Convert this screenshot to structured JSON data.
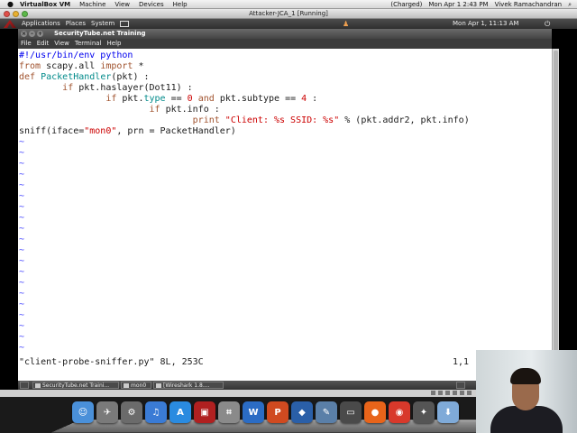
{
  "mac_menubar": {
    "apple": "",
    "menus": [
      "VirtualBox VM",
      "Machine",
      "View",
      "Devices",
      "Help"
    ],
    "status": [
      "(Charged)",
      "Mon Apr 1  2:43 PM",
      "Vivek Ramachandran"
    ]
  },
  "vbox_window": {
    "title": "Attacker-JCA_1 [Running]"
  },
  "gnome_panel": {
    "menus": [
      "Applications",
      "Places",
      "System"
    ],
    "clock": "Mon Apr 1, 11:13 AM"
  },
  "terminal": {
    "title": "SecurityTube.net Training",
    "menu": [
      "File",
      "Edit",
      "View",
      "Terminal",
      "Help"
    ]
  },
  "editor": {
    "tokens": {
      "l1": "#!/usr/bin/env python",
      "l2a": "from",
      "l2b": " scapy.all ",
      "l2c": "import",
      "l2d": " *",
      "l3a": "def",
      "l3b": " ",
      "l3c": "PacketHandler",
      "l3d": "(pkt) :",
      "l4a": "        ",
      "l4b": "if",
      "l4c": " pkt.haslayer(Dot11) :",
      "l5a": "                ",
      "l5b": "if",
      "l5c": " pkt.",
      "l5d": "type",
      "l5e": " == ",
      "l5f": "0",
      "l5g": " ",
      "l5h": "and",
      "l5i": " pkt.subtype == ",
      "l5j": "4",
      "l5k": " :",
      "l6a": "                        ",
      "l6b": "if",
      "l6c": " pkt.info :",
      "l7a": "                                ",
      "l7b": "print",
      "l7c": " ",
      "l7d": "\"Client: %s SSID: %s\"",
      "l7e": " % (pkt.addr2, pkt.info)",
      "l8a": "sniff(iface=",
      "l8b": "\"mon0\"",
      "l8c": ", prn = PacketHandler)"
    },
    "tilde": "~",
    "tilde_count": 20,
    "status_line": "\"client-probe-sniffer.py\" 8L, 253C",
    "cursor_pos": "1,1"
  },
  "taskbar": {
    "items": [
      "SecurityTube.net Traini...",
      "mon0",
      "[Wireshark 1.8...."
    ]
  },
  "dock": {
    "icons": [
      {
        "name": "finder-icon",
        "color": "#4a90d9",
        "glyph": "☺"
      },
      {
        "name": "launchpad-icon",
        "color": "#7a7a7a",
        "glyph": "✈"
      },
      {
        "name": "system-preferences-icon",
        "color": "#6b6b6b",
        "glyph": "⚙"
      },
      {
        "name": "itunes-icon",
        "color": "#3a7bd5",
        "glyph": "♫"
      },
      {
        "name": "app-store-icon",
        "color": "#2a8be0",
        "glyph": "A"
      },
      {
        "name": "photo-booth-icon",
        "color": "#b02020",
        "glyph": "▣"
      },
      {
        "name": "preview-icon",
        "color": "#8a8a8a",
        "glyph": "⌗"
      },
      {
        "name": "word-icon",
        "color": "#2b6cc4",
        "glyph": "W"
      },
      {
        "name": "powerpoint-icon",
        "color": "#d04a20",
        "glyph": "P"
      },
      {
        "name": "virtualbox-icon",
        "color": "#2a5fa8",
        "glyph": "◆"
      },
      {
        "name": "editor-icon",
        "color": "#5a7fa8",
        "glyph": "✎"
      },
      {
        "name": "screenshot-icon",
        "color": "#4a4a4a",
        "glyph": "▭"
      },
      {
        "name": "firefox-icon",
        "color": "#e8641a",
        "glyph": "●"
      },
      {
        "name": "chrome-icon",
        "color": "#d8392b",
        "glyph": "◉"
      },
      {
        "name": "screenflow-icon",
        "color": "#555555",
        "glyph": "✦"
      },
      {
        "name": "downloads-icon",
        "color": "#7faad8",
        "glyph": "⬇"
      }
    ]
  }
}
